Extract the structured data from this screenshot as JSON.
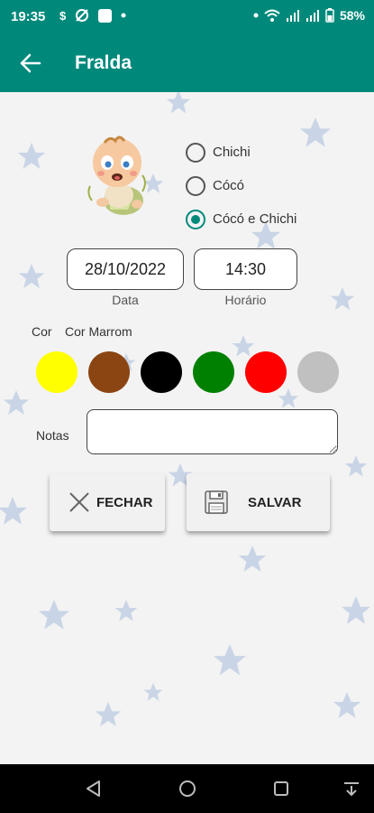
{
  "status_bar": {
    "time": "19:35",
    "battery": "58%",
    "left_icons": [
      "dollar-icon",
      "sync-off-icon",
      "app-square-icon",
      "dot-icon"
    ],
    "right_icons": [
      "dot-icon",
      "wifi-icon",
      "signal-icon",
      "signal-icon",
      "battery-icon"
    ]
  },
  "app_bar": {
    "title": "Fralda",
    "back_icon": "arrow-left-icon"
  },
  "diaper_type": {
    "options": [
      {
        "label": "Chichi",
        "selected": false
      },
      {
        "label": "Cócó",
        "selected": false
      },
      {
        "label": "Cócó e Chichi",
        "selected": true
      }
    ]
  },
  "date": {
    "value": "28/10/2022",
    "label": "Data"
  },
  "time": {
    "value": "14:30",
    "label": "Horário"
  },
  "color": {
    "label": "Cor",
    "selected_name": "Cor Marrom",
    "options": [
      {
        "hex": "#ffff00"
      },
      {
        "hex": "#8b4513"
      },
      {
        "hex": "#000000"
      },
      {
        "hex": "#008000"
      },
      {
        "hex": "#ff0000"
      },
      {
        "hex": "#c0c0c0"
      }
    ]
  },
  "notes": {
    "label": "Notas",
    "value": ""
  },
  "buttons": {
    "close": {
      "label": "FECHAR",
      "icon": "x-icon"
    },
    "save": {
      "label": "SALVAR",
      "icon": "floppy-disk-icon"
    }
  },
  "theme": {
    "primary": "#00897b",
    "star_color": "#c9d5e6"
  }
}
